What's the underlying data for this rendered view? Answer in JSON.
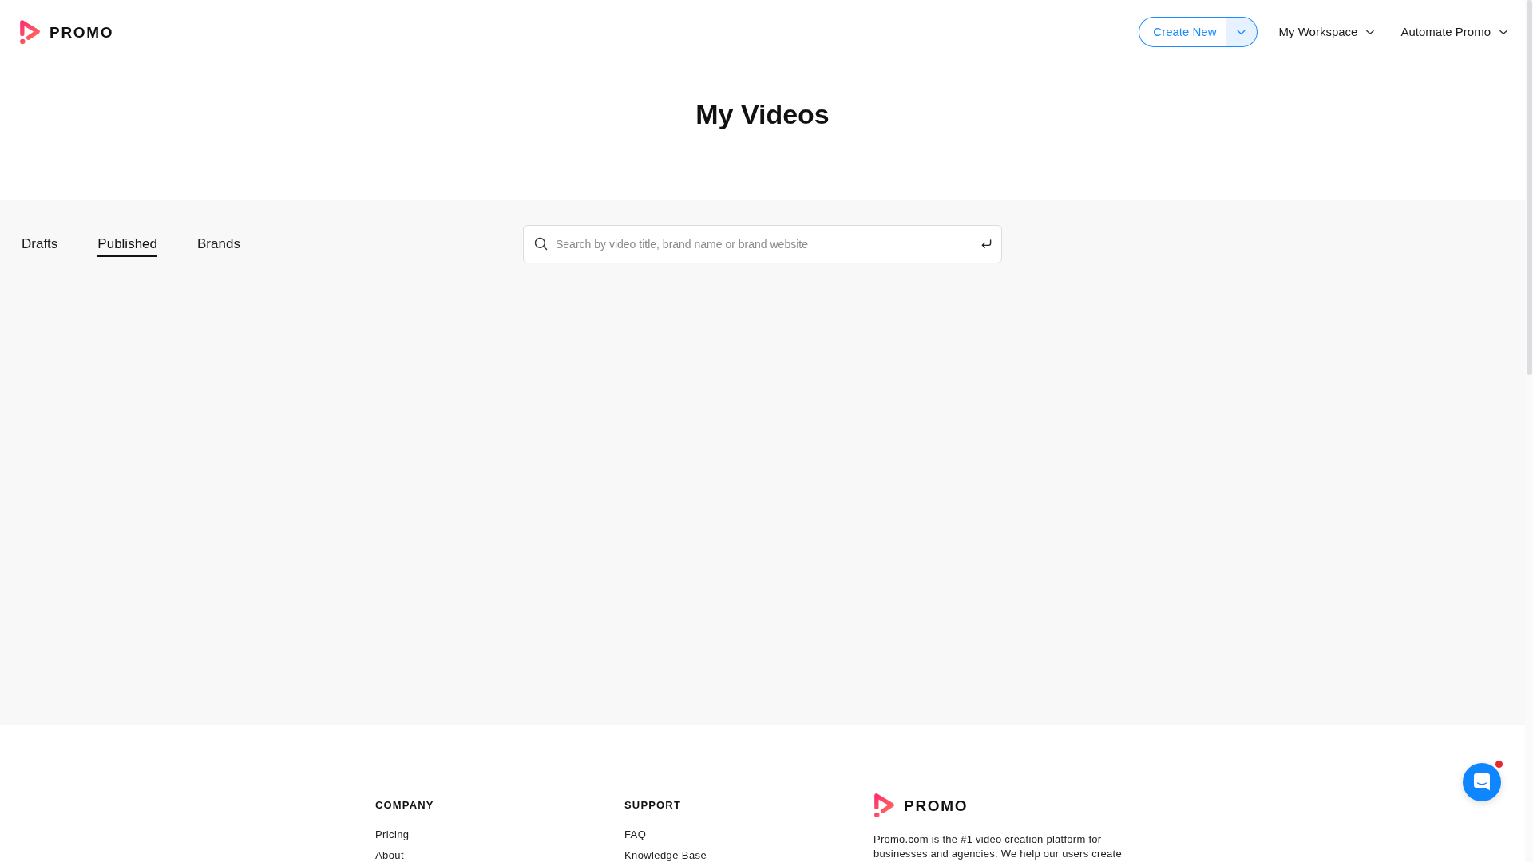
{
  "header": {
    "logo_text": "PROMO",
    "create_button": {
      "label": "Create New"
    },
    "nav": [
      {
        "label": "My Workspace"
      },
      {
        "label": "Automate Promo"
      }
    ]
  },
  "page_title": "My Videos",
  "tabs": [
    {
      "label": "Drafts",
      "selected": false
    },
    {
      "label": "Published",
      "selected": true
    },
    {
      "label": "Brands",
      "selected": false
    }
  ],
  "search": {
    "placeholder": "Search by video title, brand name or brand website"
  },
  "footer": {
    "columns": [
      {
        "heading": "COMPANY",
        "links": [
          "Pricing",
          "About"
        ]
      },
      {
        "heading": "SUPPORT",
        "links": [
          "FAQ",
          "Knowledge Base"
        ]
      }
    ],
    "brand": {
      "logo_text": "PROMO",
      "description": "Promo.com is the #1 video creation platform for businesses and agencies. We help our users create"
    }
  },
  "chat": {
    "unread": true
  }
}
